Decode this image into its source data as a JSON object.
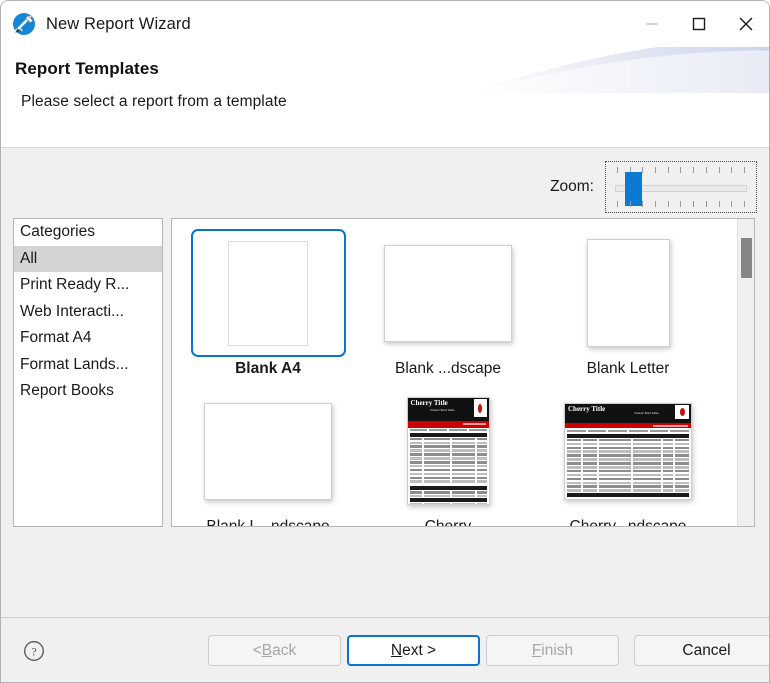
{
  "window": {
    "title": "New Report Wizard",
    "app_icon": "report-wizard-icon",
    "controls": {
      "minimize": "minimize-icon",
      "maximize": "maximize-icon",
      "close": "close-icon"
    }
  },
  "header": {
    "title": "Report Templates",
    "subtitle": "Please select a report from a template"
  },
  "zoom": {
    "label": "Zoom:",
    "value_percent": 13,
    "tick_count": 11
  },
  "categories": {
    "header": "Categories",
    "items": [
      {
        "label": "All",
        "selected": true
      },
      {
        "label": "Print Ready R...",
        "selected": false
      },
      {
        "label": "Web Interacti...",
        "selected": false
      },
      {
        "label": "Format A4",
        "selected": false
      },
      {
        "label": "Format Lands...",
        "selected": false
      },
      {
        "label": "Report Books",
        "selected": false
      }
    ]
  },
  "gallery": {
    "templates": [
      {
        "label": "Blank A4",
        "kind": "blank-a4",
        "selected": true
      },
      {
        "label": "Blank ...dscape",
        "kind": "blank-landscape",
        "selected": false
      },
      {
        "label": "Blank Letter",
        "kind": "blank-portrait",
        "selected": false
      },
      {
        "label": "Blank L...ndscape",
        "kind": "blank-landscape",
        "selected": false
      },
      {
        "label": "Cherry",
        "kind": "cherry-portrait",
        "selected": false
      },
      {
        "label": "Cherry...ndscape",
        "kind": "cherry-landscape",
        "selected": false
      }
    ],
    "cherry": {
      "title": "Cherry Title",
      "subtitle": "Classic Bold Table"
    },
    "scroll_position": "top"
  },
  "footer": {
    "help": "help-icon",
    "buttons": {
      "back": {
        "prefix": "< ",
        "mnemonic": "B",
        "rest": "ack",
        "disabled": true
      },
      "next": {
        "mnemonic": "N",
        "rest": "ext >",
        "default": true
      },
      "finish": {
        "mnemonic": "F",
        "rest": "inish",
        "disabled": true
      },
      "cancel": {
        "label": "Cancel"
      }
    }
  },
  "colors": {
    "accent": "#0b72cf",
    "slider_thumb": "#0b7ad1",
    "body_bg": "#f0f0f0",
    "selection_bg": "#d4d4d4",
    "cherry_red": "#cc0000"
  }
}
